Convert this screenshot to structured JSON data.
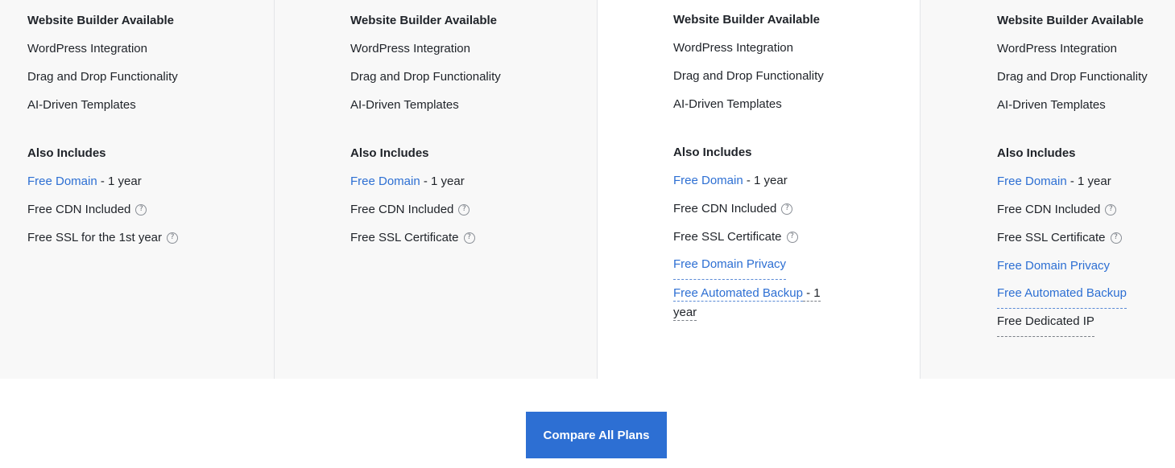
{
  "plans": [
    {
      "builder_heading": "Website Builder Available",
      "builder_items": [
        "WordPress Integration",
        "Drag and Drop Functionality",
        "AI-Driven Templates"
      ],
      "also_heading": "Also Includes",
      "domain_link": "Free Domain",
      "domain_suffix": " - 1 year",
      "cdn": "Free CDN Included",
      "ssl": "Free SSL for the 1st year"
    },
    {
      "builder_heading": "Website Builder Available",
      "builder_items": [
        "WordPress Integration",
        "Drag and Drop Functionality",
        "AI-Driven Templates"
      ],
      "also_heading": "Also Includes",
      "domain_link": "Free Domain",
      "domain_suffix": " - 1 year",
      "cdn": "Free CDN Included",
      "ssl": "Free SSL Certificate"
    },
    {
      "builder_heading": "Website Builder Available",
      "builder_items": [
        "WordPress Integration",
        "Drag and Drop Functionality",
        "AI-Driven Templates"
      ],
      "also_heading": "Also Includes",
      "domain_link": "Free Domain",
      "domain_suffix": " - 1 year",
      "cdn": "Free CDN Included",
      "ssl": "Free SSL Certificate",
      "privacy_link": "Free Domain Privacy",
      "backup_link": "Free Automated Backup",
      "backup_suffix": " - 1",
      "backup_suffix_line2": "year"
    },
    {
      "builder_heading": "Website Builder Available",
      "builder_items": [
        "WordPress Integration",
        "Drag and Drop Functionality",
        "AI-Driven Templates"
      ],
      "also_heading": "Also Includes",
      "domain_link": "Free Domain",
      "domain_suffix": " - 1 year",
      "cdn": "Free CDN Included",
      "ssl": "Free SSL Certificate",
      "privacy_link": "Free Domain Privacy",
      "backup_link": "Free Automated Backup",
      "dedicated_ip": "Free Dedicated IP"
    }
  ],
  "help_glyph": "?",
  "cta": {
    "label": "Compare All Plans"
  },
  "colors": {
    "link": "#2d6fd3",
    "button": "#2d6fd3",
    "panel": "#f8f8f8"
  }
}
